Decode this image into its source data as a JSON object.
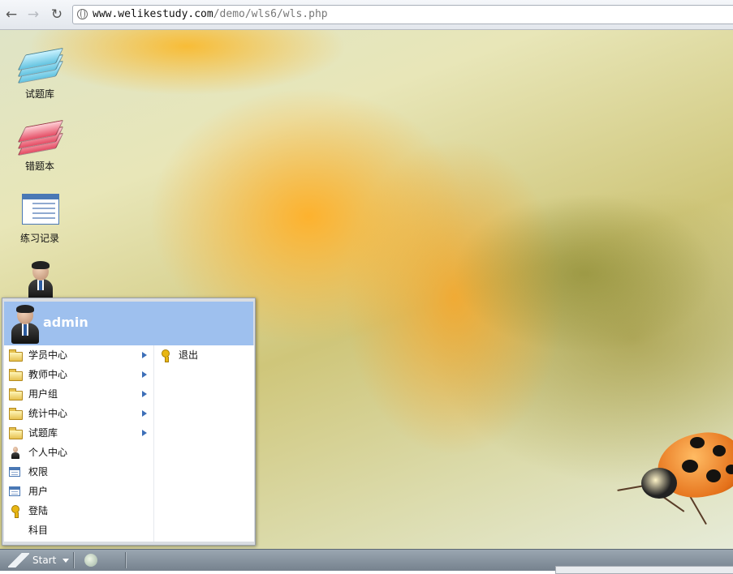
{
  "browser": {
    "url_host": "www.welikestudy.com",
    "url_path": "/demo/wls6/wls.php"
  },
  "desktop": {
    "icons": [
      {
        "label": "试题库",
        "icon": "question-bank-icon"
      },
      {
        "label": "错题本",
        "icon": "wrong-questions-icon"
      },
      {
        "label": "练习记录",
        "icon": "practice-record-icon"
      },
      {
        "label": "",
        "icon": "user-avatar-icon"
      }
    ]
  },
  "start_menu": {
    "user": "admin",
    "left_items": [
      {
        "label": "学员中心",
        "icon": "folder-icon",
        "submenu": true
      },
      {
        "label": "教师中心",
        "icon": "folder-icon",
        "submenu": true
      },
      {
        "label": "用户组",
        "icon": "folder-icon",
        "submenu": true
      },
      {
        "label": "统计中心",
        "icon": "folder-icon",
        "submenu": true
      },
      {
        "label": "试题库",
        "icon": "folder-icon",
        "submenu": true
      },
      {
        "label": "个人中心",
        "icon": "person-icon",
        "submenu": false
      },
      {
        "label": "权限",
        "icon": "window-icon",
        "submenu": false
      },
      {
        "label": "用户",
        "icon": "window-icon",
        "submenu": false
      },
      {
        "label": "登陆",
        "icon": "key-icon",
        "submenu": false
      },
      {
        "label": "科目",
        "icon": "",
        "submenu": false
      }
    ],
    "right_items": [
      {
        "label": "退出",
        "icon": "key-icon"
      }
    ]
  },
  "taskbar": {
    "start_label": "Start"
  },
  "colors": {
    "menu_header": "#9ec0ee",
    "taskbar": "#8692a0",
    "submenu_arrow": "#3d6fb8"
  }
}
